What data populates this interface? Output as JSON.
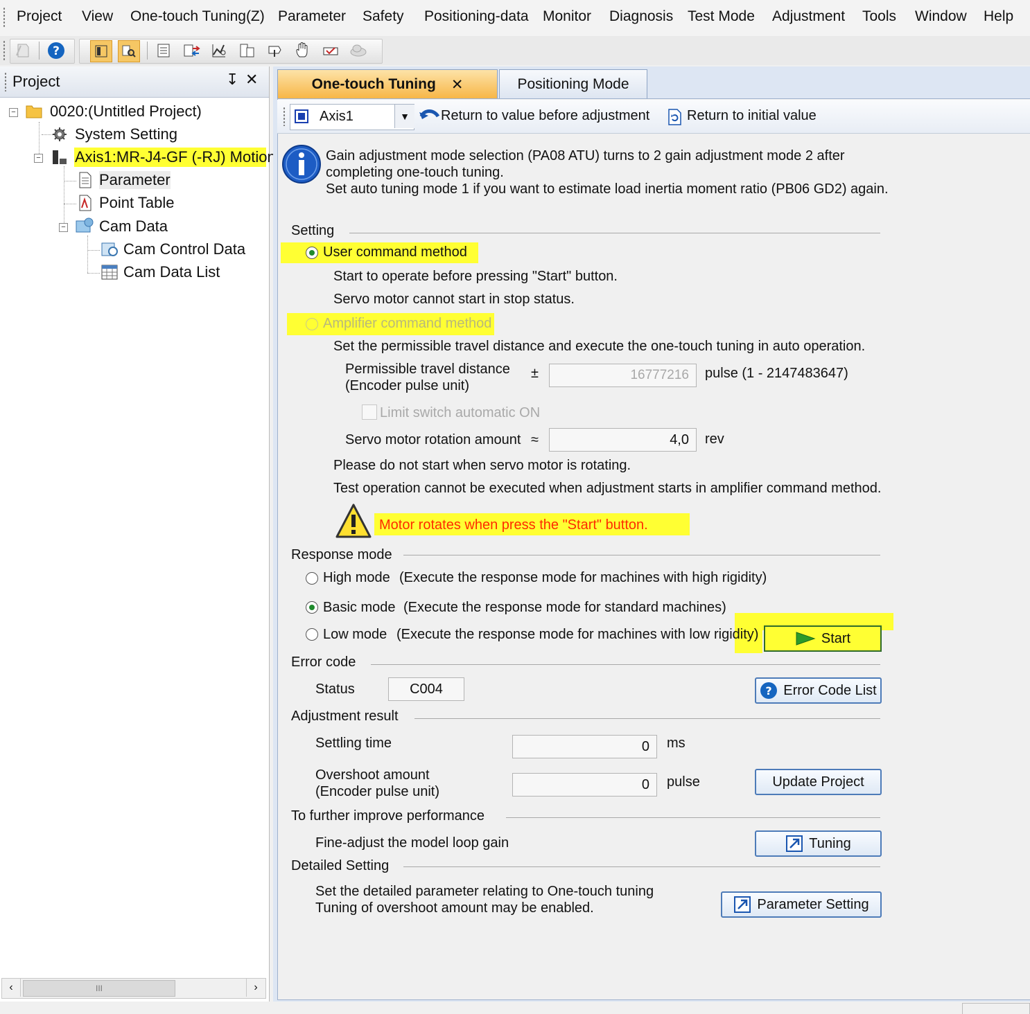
{
  "menu": [
    "Project",
    "View",
    "One-touch Tuning(Z)",
    "Parameter",
    "Safety",
    "Positioning-data",
    "Monitor",
    "Diagnosis",
    "Test Mode",
    "Adjustment",
    "Tools",
    "Window",
    "Help"
  ],
  "toolbar_icons": [
    "print-icon",
    "help-icon",
    "layout-icon",
    "search-tree-icon",
    "parameter-list-icon",
    "transfer-icon",
    "graph-icon",
    "document-icon",
    "tuning-icon",
    "hand-icon",
    "shoe-icon",
    "cloud-icon"
  ],
  "project_panel": {
    "title": "Project",
    "pin": "↧",
    "close": "✕",
    "tree": {
      "root": "0020:(Untitled Project)",
      "system_setting": "System Setting",
      "axis": "Axis1:MR-J4-GF (-RJ) Motion",
      "parameter": "Parameter",
      "point_table": "Point Table",
      "cam_data": "Cam Data",
      "cam_control_data": "Cam Control Data",
      "cam_data_list": "Cam Data List"
    },
    "scroll_mid": "III"
  },
  "tabs": {
    "active": "One-touch Tuning",
    "close": "✕",
    "other": "Positioning Mode"
  },
  "axis_bar": {
    "axis_value": "Axis1",
    "return_before": "Return to value before adjustment",
    "return_initial": "Return to initial value"
  },
  "info": {
    "line1": "Gain adjustment mode selection (PA08 ATU) turns to 2 gain adjustment mode 2 after",
    "line2": "completing one-touch tuning.",
    "line3": "Set auto tuning mode 1 if you want to estimate load inertia moment ratio (PB06 GD2) again."
  },
  "setting": {
    "header": "Setting",
    "user_method": "User command method",
    "user_desc1": "Start to operate before pressing \"Start\" button.",
    "user_desc2": "Servo motor cannot start in stop status.",
    "amp_method": "Amplifier command method",
    "amp_desc": "Set the permissible travel distance and execute the one-touch tuning in auto operation.",
    "travel_label1": "Permissible travel distance",
    "travel_label2": "(Encoder pulse unit)",
    "plus_minus": "±",
    "travel_value": "16777216",
    "travel_unit": "pulse (1 - 2147483647)",
    "limit_switch": "Limit switch automatic ON",
    "rotation_label": "Servo motor rotation amount",
    "approx": "≈",
    "rotation_value": "4,0",
    "rotation_unit": "rev",
    "note1": "Please do not start when servo motor is rotating.",
    "note2": "Test operation cannot be executed when adjustment starts in amplifier command method.",
    "warning": "Motor rotates when press the \"Start\" button."
  },
  "response": {
    "header": "Response mode",
    "high": "High mode",
    "high_desc": "(Execute the response mode for machines with high rigidity)",
    "basic": "Basic mode",
    "basic_desc": "(Execute the response mode for standard machines)",
    "low": "Low mode",
    "low_desc": "(Execute the response mode for machines with low rigidity)",
    "start": "Start"
  },
  "error": {
    "header": "Error code",
    "status_label": "Status",
    "status_value": "C004",
    "list_button": "Error Code List"
  },
  "result": {
    "header": "Adjustment result",
    "settling_label": "Settling time",
    "settling_value": "0",
    "settling_unit": "ms",
    "overshoot_label1": "Overshoot amount",
    "overshoot_label2": "(Encoder pulse unit)",
    "overshoot_value": "0",
    "overshoot_unit": "pulse",
    "update_button": "Update Project"
  },
  "improve": {
    "header": "To further improve performance",
    "fine_adjust": "Fine-adjust the model loop gain",
    "tuning_button": "Tuning"
  },
  "detailed": {
    "header": "Detailed Setting",
    "desc1": "Set the detailed parameter relating to One-touch tuning",
    "desc2": "Tuning of overshoot amount may be enabled.",
    "param_button": "Parameter Setting"
  },
  "colors": {
    "highlight": "#ffff33",
    "accent_blue": "#4d7bb8",
    "tab_active": "#f7b545",
    "warning_red": "#ff2a00",
    "start_green": "#2c9a2a"
  }
}
